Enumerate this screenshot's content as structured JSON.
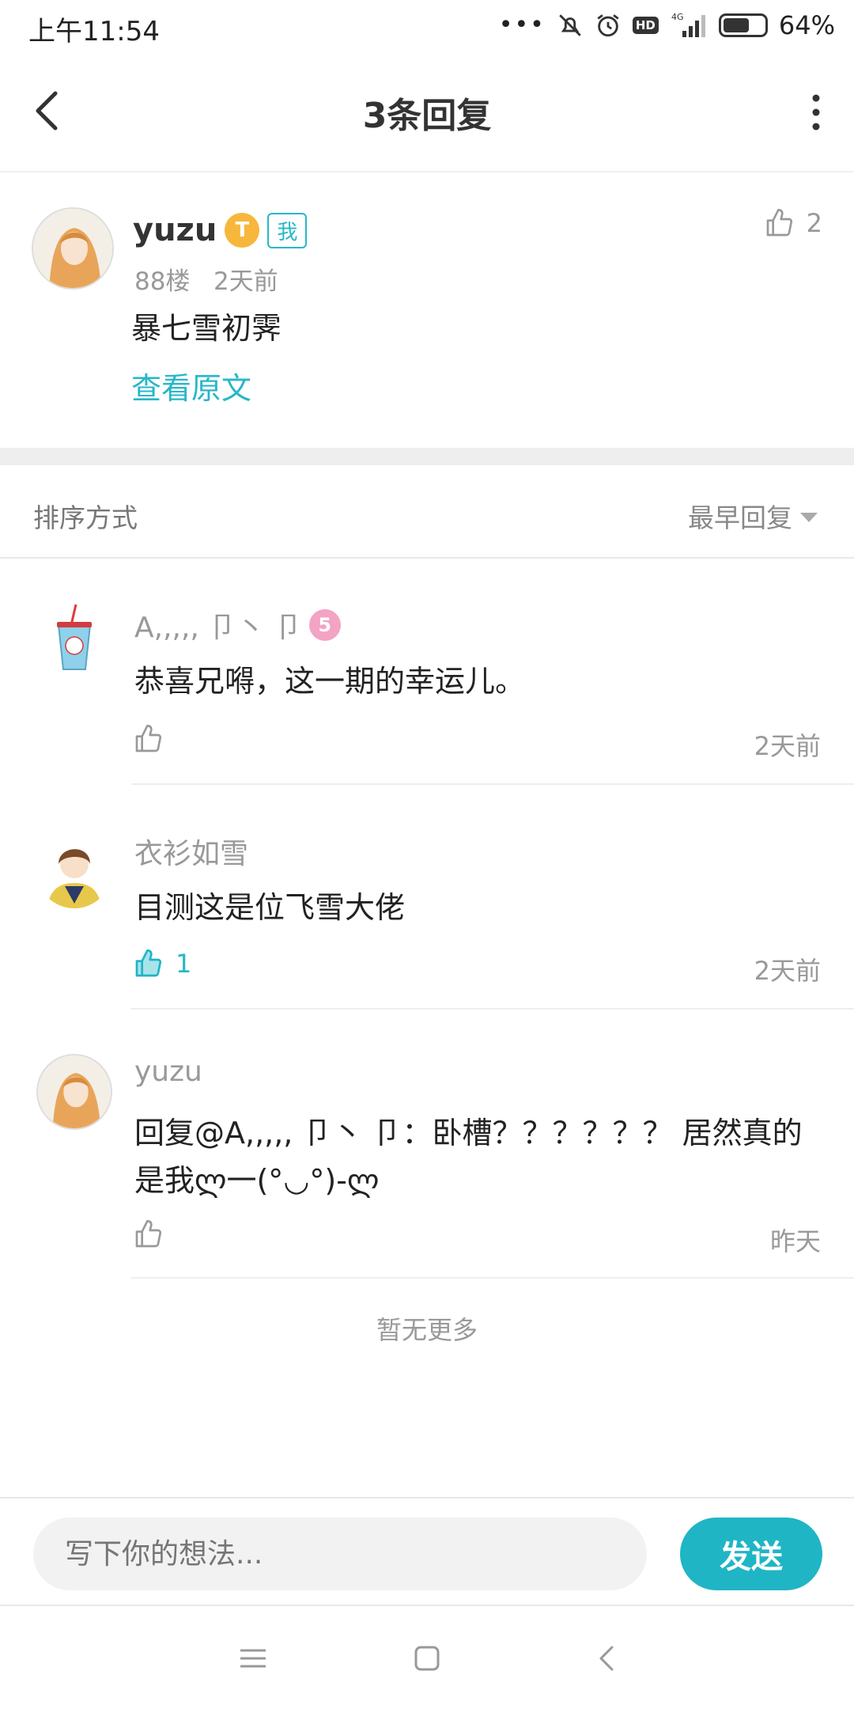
{
  "status_bar": {
    "time": "上午11:54",
    "network": "4G",
    "hd": "HD",
    "battery": "64%",
    "battery_level": 0.64
  },
  "header": {
    "title": "3条回复"
  },
  "post": {
    "username": "yuzu",
    "level_badge": "T",
    "me_tag": "我",
    "floor": "88楼",
    "time": "2天前",
    "content": "暴七雪初霁",
    "view_original": "查看原文",
    "like_count": "2"
  },
  "sort": {
    "label": "排序方式",
    "value": "最早回复"
  },
  "replies": [
    {
      "username": "A,,,,, 卩丶 卩",
      "badge": "5",
      "content": "恭喜兄嘚，这一期的幸运儿。",
      "likes": "",
      "liked": false,
      "time": "2天前"
    },
    {
      "username": "衣衫如雪",
      "badge": "",
      "content": "目测这是位飞雪大佬",
      "likes": "1",
      "liked": true,
      "time": "2天前"
    },
    {
      "username": "yuzu",
      "badge": "",
      "content": "回复@A,,,,, 卩丶 卩：卧槽？？？？？？ 居然真的是我ლ一(°◡°)-ლ",
      "likes": "",
      "liked": false,
      "time": "昨天"
    }
  ],
  "no_more": "暂无更多",
  "composer": {
    "placeholder": "写下你的想法...",
    "send_label": "发送"
  },
  "colors": {
    "accent": "#1fb5c5",
    "muted": "#999999"
  }
}
